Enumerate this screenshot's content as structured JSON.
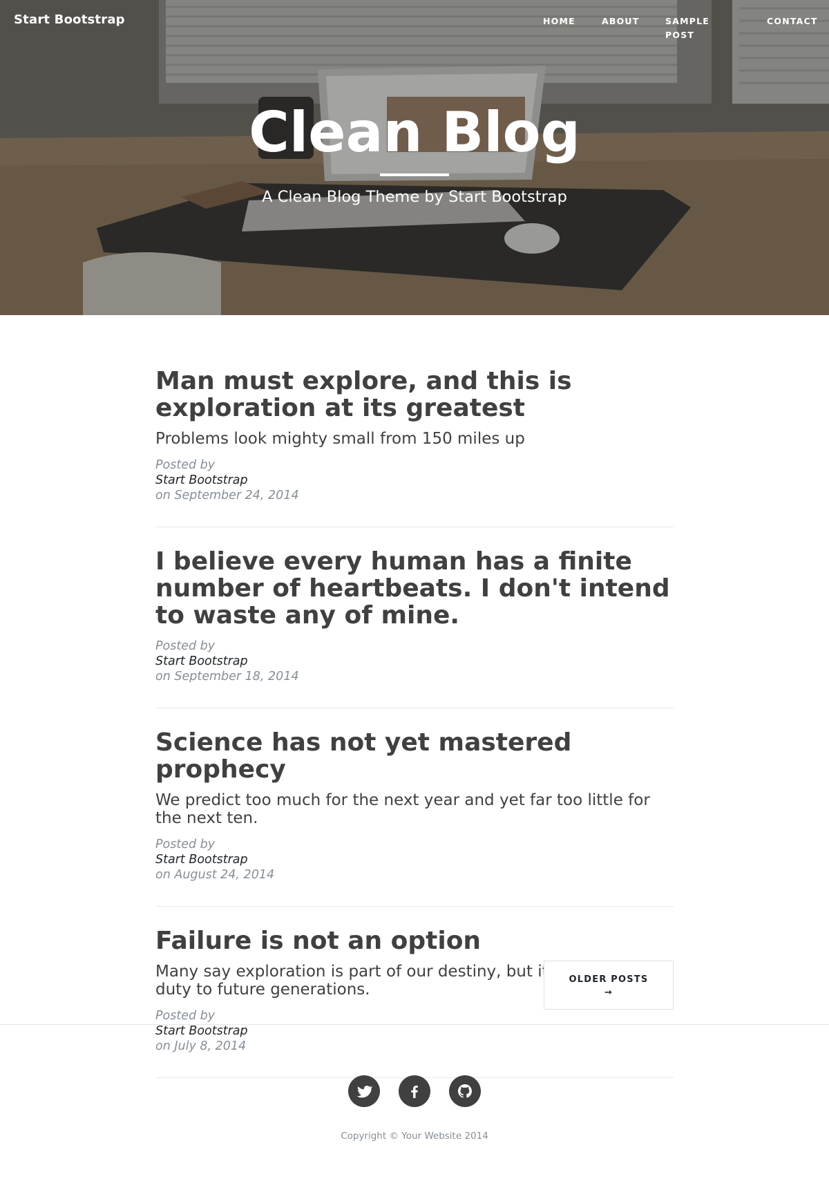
{
  "nav": {
    "brand": "Start Bootstrap",
    "items": [
      {
        "label": "HOME"
      },
      {
        "label": "ABOUT"
      },
      {
        "label": "SAMPLE POST"
      },
      {
        "label": "CONTACT"
      }
    ]
  },
  "hero": {
    "title": "Clean Blog",
    "subtitle": "A Clean Blog Theme by Start Bootstrap"
  },
  "posts": [
    {
      "title": "Man must explore, and this is exploration at its greatest",
      "subtitle": "Problems look mighty small from 150 miles up",
      "meta_prefix": "Posted by",
      "author": "Start Bootstrap",
      "meta_suffix": "on September 24, 2014"
    },
    {
      "title": "I believe every human has a finite number of heartbeats. I don't intend to waste any of mine.",
      "subtitle": "",
      "meta_prefix": "Posted by",
      "author": "Start Bootstrap",
      "meta_suffix": "on September 18, 2014"
    },
    {
      "title": "Science has not yet mastered prophecy",
      "subtitle": "We predict too much for the next year and yet far too little for the next ten.",
      "meta_prefix": "Posted by",
      "author": "Start Bootstrap",
      "meta_suffix": "on August 24, 2014"
    },
    {
      "title": "Failure is not an option",
      "subtitle": "Many say exploration is part of our destiny, but it’s actually our duty to future generations.",
      "meta_prefix": "Posted by",
      "author": "Start Bootstrap",
      "meta_suffix": "on July 8, 2014"
    }
  ],
  "pager": {
    "older_label": "OLDER POSTS",
    "older_arrow": "→"
  },
  "footer": {
    "social": [
      {
        "icon": "twitter-icon"
      },
      {
        "icon": "facebook-icon"
      },
      {
        "icon": "github-icon"
      }
    ],
    "copyright": "Copyright © Your Website 2014"
  },
  "colors": {
    "text": "#404040",
    "meta": "#868e96",
    "border": "#e8e8e8",
    "social_bg": "#404040"
  }
}
